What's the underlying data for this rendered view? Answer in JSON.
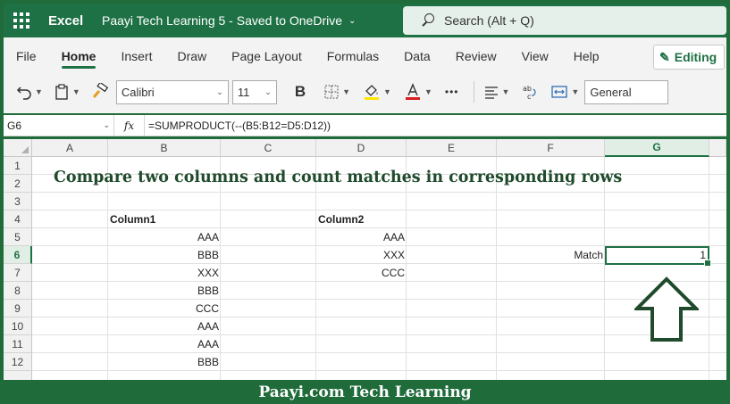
{
  "titlebar": {
    "app_name": "Excel",
    "doc_name": "Paayi Tech Learning 5  -  Saved to OneDrive",
    "search_placeholder": "Search (Alt + Q)"
  },
  "ribbon": {
    "tabs": [
      "File",
      "Home",
      "Insert",
      "Draw",
      "Page Layout",
      "Formulas",
      "Data",
      "Review",
      "View",
      "Help"
    ],
    "active_tab": "Home",
    "editing_label": "Editing",
    "font_name": "Calibri",
    "font_size": "11",
    "bold_label": "B",
    "more_label": "•••",
    "number_format": "General",
    "accent_color": "#1e7145"
  },
  "formula_bar": {
    "name_box": "G6",
    "fx_label": "fx",
    "formula": "=SUMPRODUCT(--(B5:B12=D5:D12))"
  },
  "grid": {
    "columns": [
      "A",
      "B",
      "C",
      "D",
      "E",
      "F",
      "G"
    ],
    "selected_column": "G",
    "rows": [
      "1",
      "2",
      "3",
      "4",
      "5",
      "6",
      "7",
      "8",
      "9",
      "10",
      "11",
      "12"
    ],
    "selected_row": "6",
    "heading": "Compare two columns and count matches in corresponding rows",
    "column1_header": "Column1",
    "column2_header": "Column2",
    "column1_values": [
      "AAA",
      "BBB",
      "XXX",
      "BBB",
      "CCC",
      "AAA",
      "AAA",
      "BBB"
    ],
    "column2_values": [
      "AAA",
      "XXX",
      "CCC"
    ],
    "match_label": "Match",
    "match_value": "1"
  },
  "footer": {
    "text": "Paayi.com Tech Learning"
  }
}
